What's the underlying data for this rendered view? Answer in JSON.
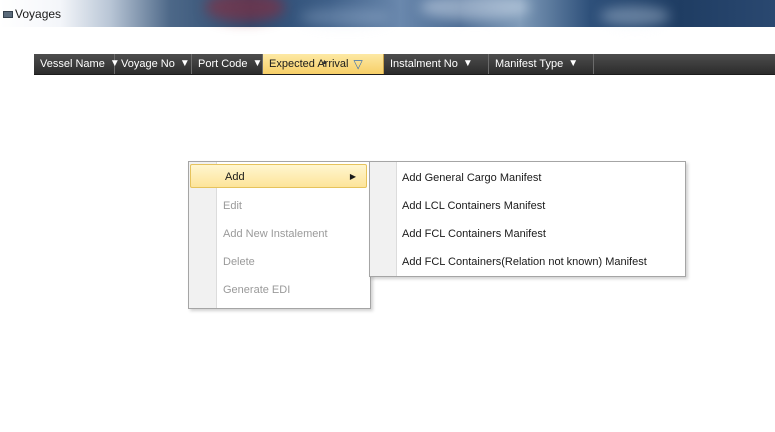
{
  "window": {
    "title": "Voyages",
    "icon": "window-minimize-icon"
  },
  "grid": {
    "columns": [
      {
        "label": "Vessel Name",
        "filter_icon": "filter-icon",
        "active": false
      },
      {
        "label": "Voyage No",
        "filter_icon": "filter-icon",
        "active": false
      },
      {
        "label": "Port Code",
        "filter_icon": "filter-icon",
        "active": false
      },
      {
        "label": "Expected Arrival",
        "filter_icon": "filter-icon",
        "active": true
      },
      {
        "label": "Instalment No",
        "filter_icon": "filter-icon",
        "active": false
      },
      {
        "label": "Manifest Type",
        "filter_icon": "filter-icon",
        "active": false
      }
    ],
    "header_color": "#3a3a3a",
    "active_header_color": "#f9d877"
  },
  "context_menu": {
    "items": [
      {
        "label": "Add",
        "enabled": true,
        "highlighted": true,
        "has_submenu": true
      },
      {
        "label": "Edit",
        "enabled": false
      },
      {
        "label": "Add New Instalement",
        "enabled": false
      },
      {
        "label": "Delete",
        "enabled": false
      },
      {
        "label": "Generate EDI",
        "enabled": false
      }
    ],
    "submenu_arrow_glyph": "▶"
  },
  "submenu": {
    "items": [
      {
        "label": "Add General Cargo Manifest"
      },
      {
        "label": "Add LCL Containers Manifest"
      },
      {
        "label": "Add FCL Containers Manifest"
      },
      {
        "label": "Add FCL Containers(Relation not known) Manifest"
      }
    ]
  }
}
